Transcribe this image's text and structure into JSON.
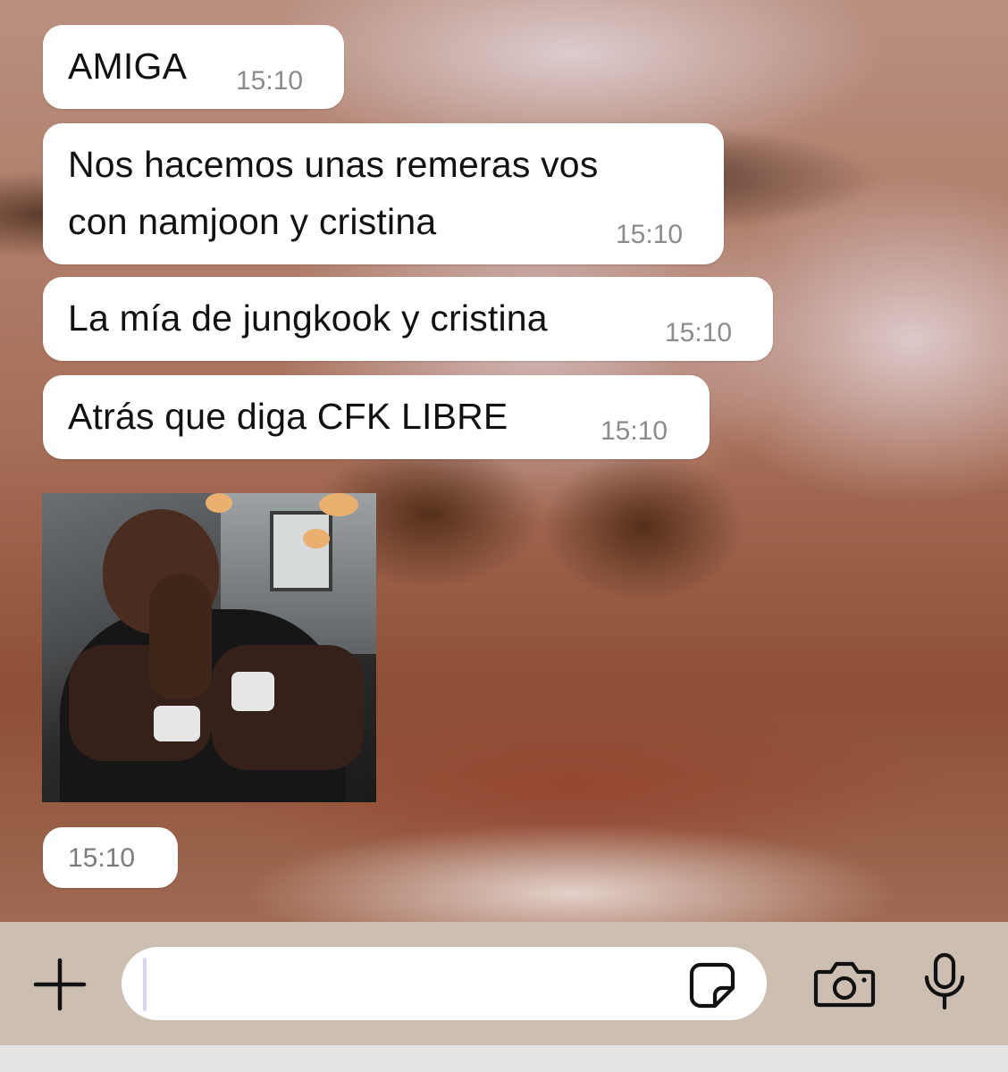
{
  "messages": [
    {
      "text": "AMIGA",
      "time": "15:10"
    },
    {
      "lines": [
        "Nos hacemos unas remeras vos",
        "con namjoon y cristina"
      ],
      "time": "15:10"
    },
    {
      "text": "La mía de jungkook y cristina",
      "time": "15:10"
    },
    {
      "text": "Atrás que diga CFK LIBRE",
      "time": "15:10"
    },
    {
      "type": "image",
      "icon": "photo-of-smiling-man-with-hands-together",
      "time": "15:10"
    }
  ],
  "composer": {
    "value": "",
    "icons": {
      "attach": "plus-icon",
      "sticker": "sticker-icon",
      "camera": "camera-icon",
      "mic": "microphone-icon"
    }
  },
  "colors": {
    "bubble": "#ffffff",
    "timestamp": "#8c8c8c",
    "input_bar": "#ccbfb2",
    "caret": "#d6d4f0"
  }
}
